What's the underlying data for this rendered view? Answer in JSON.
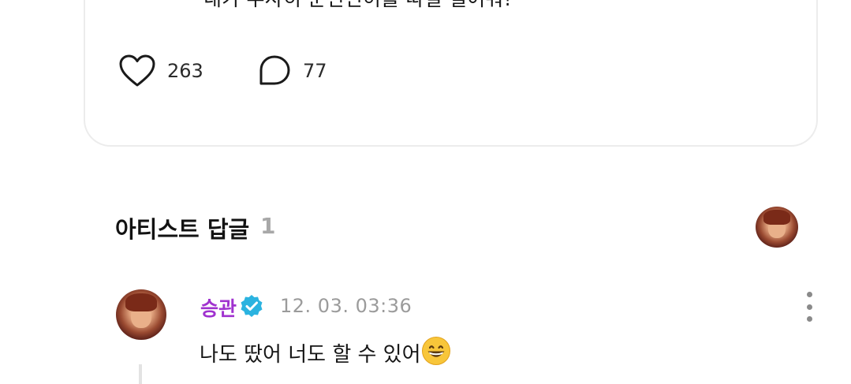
{
  "post": {
    "text": "내가 무사히 운전면허를 따길 빌어줘!",
    "likes": "263",
    "comments": "77"
  },
  "artist_replies": {
    "title": "아티스트 답글",
    "count": "1"
  },
  "reply": {
    "author": "승관",
    "timestamp": "12. 03. 03:36",
    "text": "나도 땄어 너도 할 수 있어",
    "emoji": "grinning-face-emoji"
  },
  "colors": {
    "author_name": "#a032cf",
    "verified_badge": "#2bb3e0",
    "muted_text": "#9b9b9b"
  }
}
